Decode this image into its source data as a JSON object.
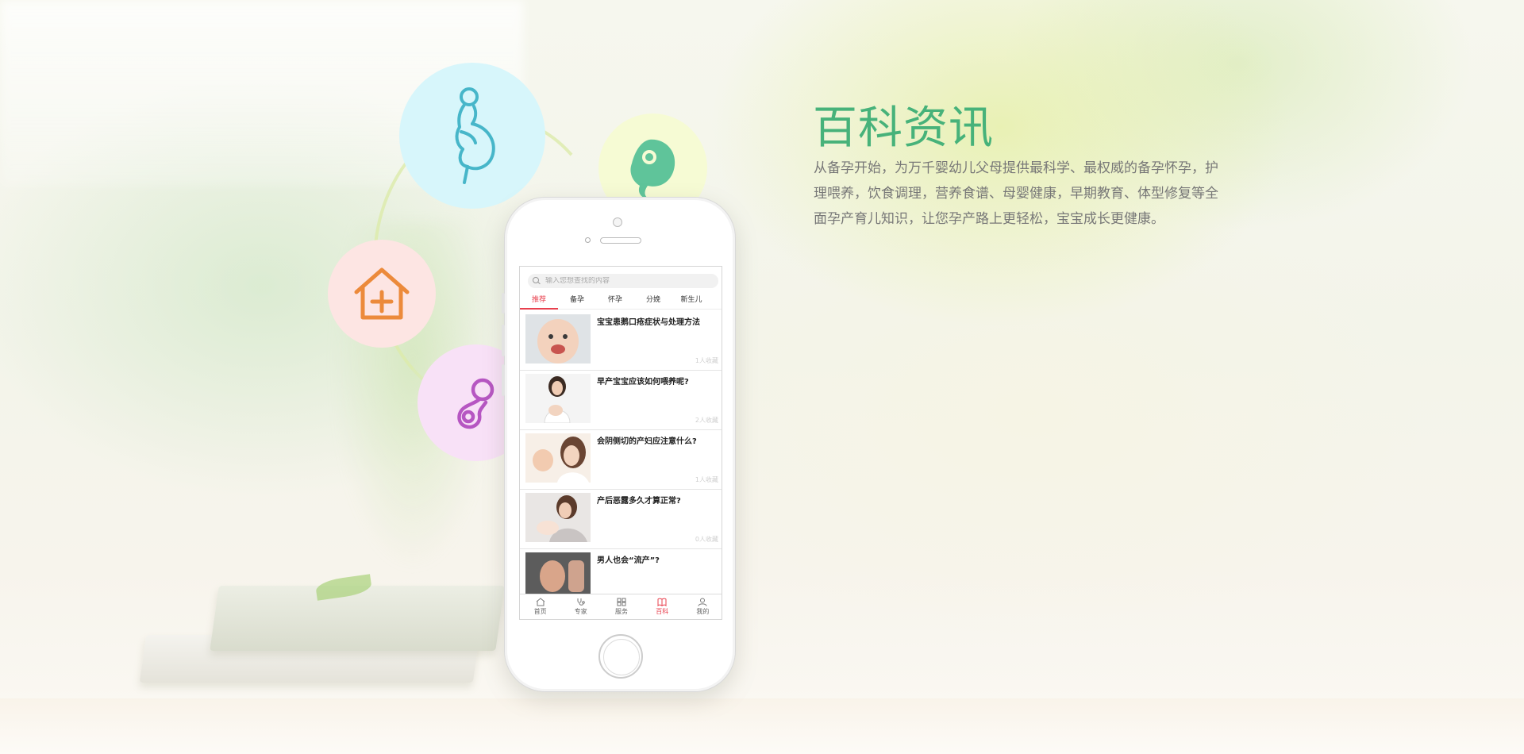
{
  "hero": {
    "title": "百科资讯",
    "description": "从备孕开始，为万千婴幼儿父母提供最科学、最权威的备孕怀孕，护理喂养，饮食调理，营养食谱、母婴健康，早期教育、体型修复等全面孕产育儿知识，让您孕产路上更轻松，宝宝成长更健康。"
  },
  "feature_icons": [
    "pregnant-woman-icon",
    "fetus-icon",
    "house-plus-icon",
    "pacifier-icon"
  ],
  "colors": {
    "accent_green": "#47b27a",
    "active_red": "#e8404e",
    "bubble_blue": "#d7f6fb",
    "bubble_yellow": "#f6fbd4",
    "bubble_pink": "#fde5e3",
    "bubble_purple": "#f8e1f7"
  },
  "app": {
    "search": {
      "placeholder": "输入您想查找的内容"
    },
    "tabs": [
      {
        "label": "推荐",
        "active": true
      },
      {
        "label": "备孕",
        "active": false
      },
      {
        "label": "怀孕",
        "active": false
      },
      {
        "label": "分娩",
        "active": false
      },
      {
        "label": "新生儿",
        "active": false
      }
    ],
    "articles": [
      {
        "title": "宝宝患鹅口疮症状与处理方法",
        "meta": "1人收藏"
      },
      {
        "title": "早产宝宝应该如何喂养呢?",
        "meta": "2人收藏"
      },
      {
        "title": "会阴侧切的产妇应注意什么?",
        "meta": "1人收藏"
      },
      {
        "title": "产后恶露多久才算正常?",
        "meta": "0人收藏"
      },
      {
        "title": "男人也会“流产”?",
        "meta": ""
      }
    ],
    "tabbar": [
      {
        "label": "首页",
        "icon": "home-icon",
        "active": false
      },
      {
        "label": "专家",
        "icon": "stethoscope-icon",
        "active": false
      },
      {
        "label": "服务",
        "icon": "grid-icon",
        "active": false
      },
      {
        "label": "百科",
        "icon": "book-icon",
        "active": true
      },
      {
        "label": "我的",
        "icon": "user-icon",
        "active": false
      }
    ]
  }
}
